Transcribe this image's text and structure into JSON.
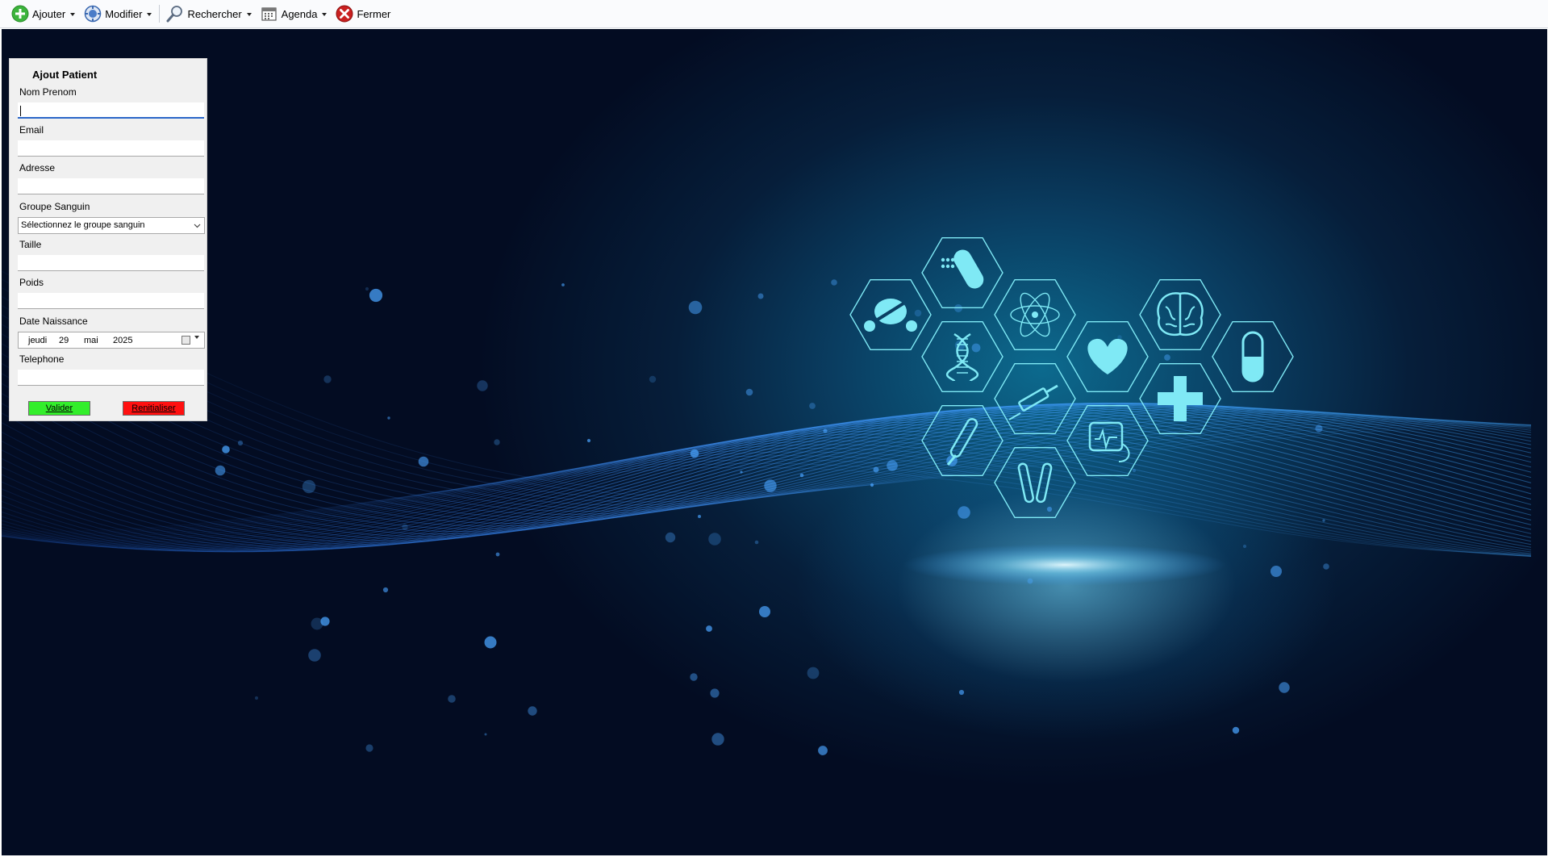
{
  "toolbar": {
    "items": [
      {
        "label": "Ajouter",
        "icon": "add-icon"
      },
      {
        "label": "Modifier",
        "icon": "modify-icon"
      },
      {
        "label": "Rechercher",
        "icon": "search-icon"
      },
      {
        "label": "Agenda",
        "icon": "calendar-icon"
      },
      {
        "label": "Fermer",
        "icon": "close-icon"
      }
    ]
  },
  "form": {
    "title": "Ajout Patient",
    "nom_prenom_label": "Nom Prenom",
    "nom_prenom_value": "",
    "email_label": "Email",
    "email_value": "",
    "adresse_label": "Adresse",
    "adresse_value": "",
    "groupe_label": "Groupe Sanguin",
    "groupe_selected": "Sélectionnez le groupe sanguin",
    "taille_label": "Taille",
    "taille_value": "",
    "poids_label": "Poids",
    "poids_value": "",
    "date_label": "Date Naissance",
    "date_day_name": "jeudi",
    "date_day": "29",
    "date_month": "mai",
    "date_year": "2025",
    "telephone_label": "Telephone",
    "telephone_value": "",
    "valider_label": "Valider",
    "reset_label": "Renitialiser"
  },
  "colors": {
    "valider_bg": "#33ee2b",
    "reset_bg": "#ff1010",
    "focus_underline": "#2a66c8",
    "background_dark": "#030c22",
    "icon_glow": "#7fe9f5"
  },
  "background": {
    "medical_icons": [
      "pills-icon",
      "capsule-pills-icon",
      "atom-icon",
      "dna-icon",
      "heart-icon",
      "brain-icon",
      "capsule-icon",
      "syringe-icon",
      "medical-cross-icon",
      "thermometer-icon",
      "test-tubes-icon",
      "monitor-icon"
    ]
  }
}
